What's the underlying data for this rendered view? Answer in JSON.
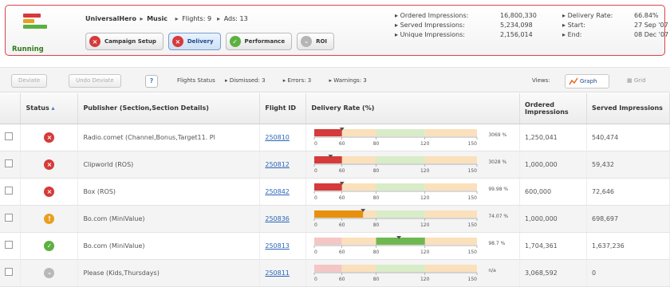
{
  "summary": {
    "status": "Running",
    "campaign": "UniversalHero",
    "category": "Music",
    "flights_label": "Flights:",
    "flights_value": "9",
    "ads_label": "Ads:",
    "ads_value": "13",
    "tabs": [
      {
        "label": "Campaign Setup",
        "icon": "x-circle-icon",
        "color": "#d63a3a",
        "active": false
      },
      {
        "label": "Delivery",
        "icon": "x-circle-icon",
        "color": "#d63a3a",
        "active": true
      },
      {
        "label": "Performance",
        "icon": "check-circle-icon",
        "color": "#5cb040",
        "active": false
      },
      {
        "label": "ROI",
        "icon": "neutral-circle-icon",
        "color": "#b5b5b5",
        "active": false
      }
    ],
    "stats": [
      {
        "label": "Ordered Impressions:",
        "value": "16,800,330",
        "label2": "Delivery Rate:",
        "value2": "66.84%"
      },
      {
        "label": "Served Impressions:",
        "value": "5,234,098",
        "label2": "Start:",
        "value2": "27 Sep '07"
      },
      {
        "label": "Unique Impressions:",
        "value": "2,156,014",
        "label2": "End:",
        "value2": "08 Dec '07"
      }
    ]
  },
  "toolbar": {
    "deviate_label": "Deviate",
    "undo_label": "Undo Deviate",
    "help_label": "?",
    "filters": [
      "Flights Status",
      "Dismissed: 3",
      "Errors: 3",
      "Warnings: 3"
    ],
    "views_label": "Views:",
    "graph_label": "Graph",
    "grid_label": "Grid"
  },
  "table": {
    "headers": {
      "status": "Status",
      "publisher": "Publisher (Section,Section Details)",
      "flight": "Flight ID",
      "rate": "Delivery Rate (%)",
      "ordered": "Ordered Impressions",
      "served": "Served Impressions"
    },
    "axis_ticks": [
      "0",
      "60",
      "80",
      "120",
      "150"
    ],
    "rows": [
      {
        "status": "error",
        "publisher": "Radio.comet (Channel,Bonus,Target11. Pl",
        "flight": "250810",
        "pct_label": "3069 %",
        "ordered": "1,250,041",
        "served": "540,474",
        "fill": 0.17,
        "fill_color": "#d63a3a",
        "marker": 0.17
      },
      {
        "status": "error",
        "publisher": "Clipworld (ROS)",
        "flight": "250812",
        "pct_label": "3028 %",
        "ordered": "1,000,000",
        "served": "59,432",
        "fill": 0.17,
        "fill_color": "#d63a3a",
        "marker": 0.1
      },
      {
        "status": "error",
        "publisher": "Box (ROS)",
        "flight": "250842",
        "pct_label": "99.98 %",
        "ordered": "600,000",
        "served": "72,646",
        "fill": 0.17,
        "fill_color": "#d63a3a",
        "marker": 0.17
      },
      {
        "status": "warning",
        "publisher": "Bo.com (MiniValue)",
        "flight": "250836",
        "pct_label": "74.07 %",
        "ordered": "1,000,000",
        "served": "698,697",
        "fill": 0.3,
        "fill_color": "#e8900e",
        "marker": 0.3
      },
      {
        "status": "ok",
        "publisher": "Bo.com (MiniValue)",
        "flight": "250813",
        "pct_label": "98.7 %",
        "ordered": "1,704,361",
        "served": "1,637,236",
        "fill": 0.68,
        "fill_color": "#6fb850",
        "marker": 0.52
      },
      {
        "status": "neutral",
        "publisher": "Please (Kids,Thursdays)",
        "flight": "250811",
        "pct_label": "n/a",
        "ordered": "3,068,592",
        "served": "0",
        "fill": 0,
        "fill_color": "#d63a3a",
        "marker": null
      }
    ]
  },
  "colors": {
    "error": "#d63a3a",
    "warning": "#e8a020",
    "ok": "#5cb040",
    "neutral": "#b8b8b8",
    "accent": "#d9434d",
    "link": "#2a66b8"
  }
}
